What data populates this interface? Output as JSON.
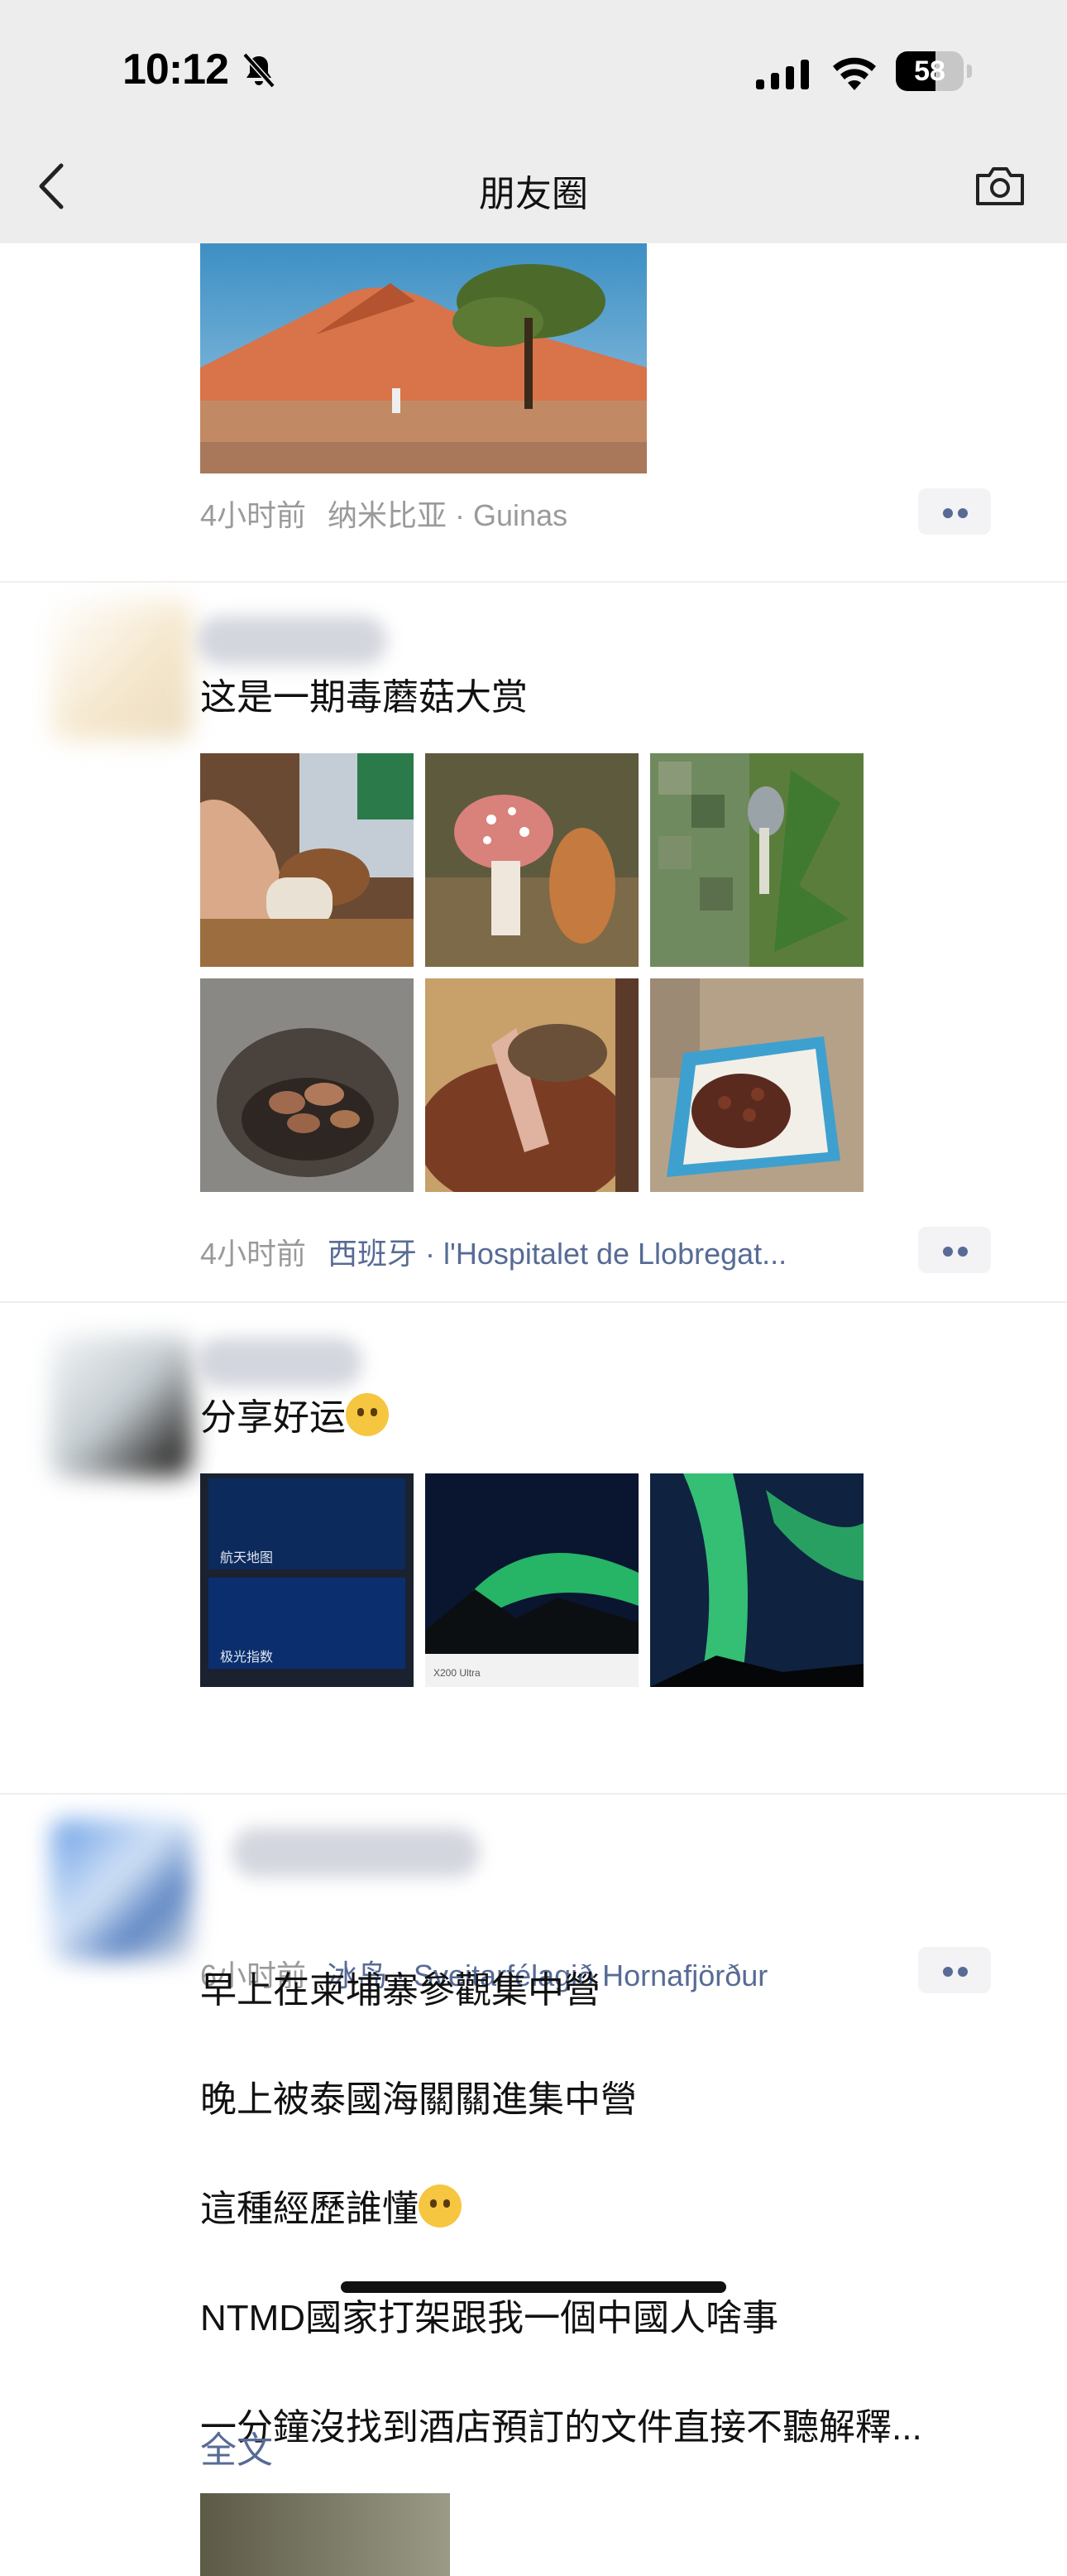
{
  "status_bar": {
    "time": "10:12",
    "battery": "58",
    "battery_level": 0.58
  },
  "nav": {
    "title": "朋友圈"
  },
  "posts": [
    {
      "time": "4小时前",
      "location": "纳米比亚 · Guinas"
    },
    {
      "text": "这是一期毒蘑菇大赏",
      "time": "4小时前",
      "location": "西班牙 · l'Hospitalet de Llobregat..."
    },
    {
      "text": "分享好运",
      "time": "6小时前",
      "location": "冰岛 · Sveitarfélagið Hornafjörður",
      "photo_captions": [
        "航天地图",
        "极光指数"
      ],
      "photo_watermark": "X200 Ultra"
    },
    {
      "lines": [
        "早上在柬埔寨參觀集中營",
        "晚上被泰國海關關進集中營",
        "這種經歷誰懂",
        "NTMD國家打架跟我一個中國人啥事",
        "一分鐘沒找到酒店預訂的文件直接不聽解釋..."
      ],
      "full_text": "全文"
    }
  ],
  "colors": {
    "link": "#576b95",
    "nav_bg": "#ededed",
    "meta": "#9a9a9a"
  }
}
